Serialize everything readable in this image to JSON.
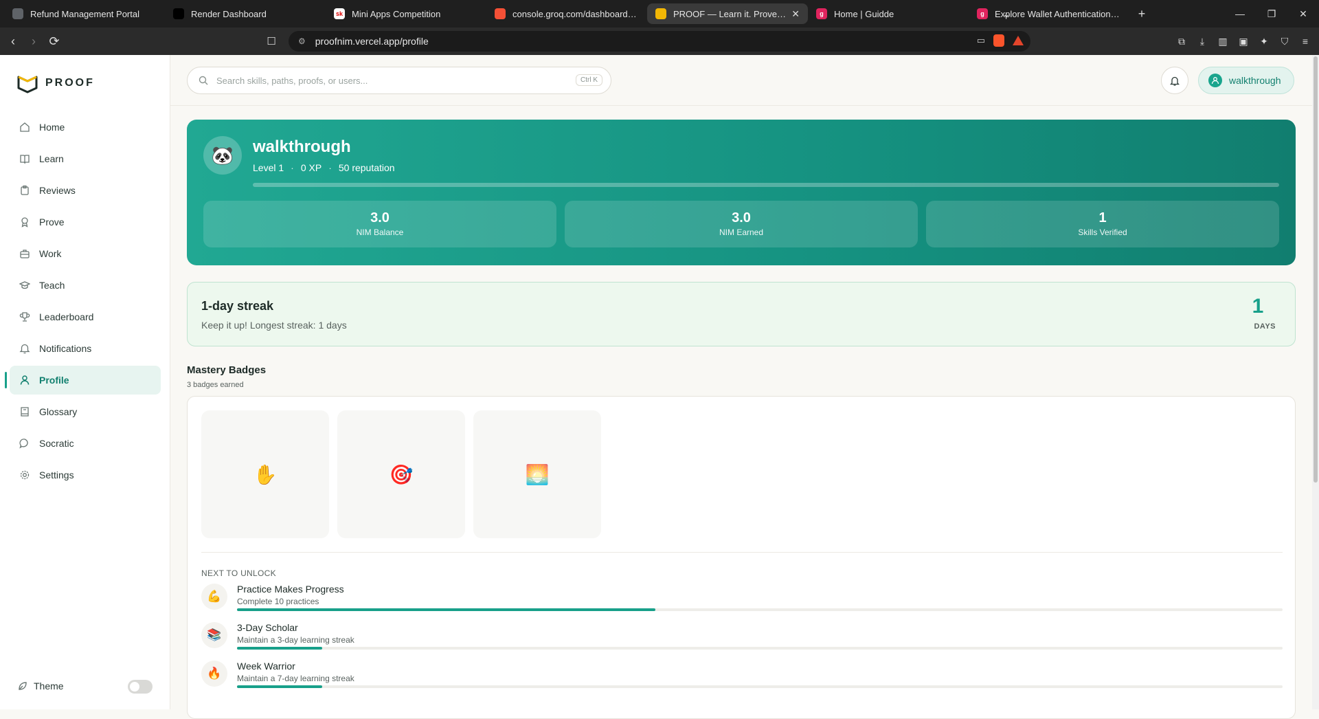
{
  "browser": {
    "tabs": [
      {
        "title": "Refund Management Portal",
        "favicon_color": "#5f6368",
        "favicon_text": ""
      },
      {
        "title": "Render Dashboard",
        "favicon_color": "#000000",
        "favicon_text": ""
      },
      {
        "title": "Mini Apps Competition",
        "favicon_color": "#ffffff",
        "favicon_text": "sk"
      },
      {
        "title": "console.groq.com/dashboard/metri",
        "favicon_color": "#f55036",
        "favicon_text": ""
      },
      {
        "title": "PROOF — Learn it. Prove it. Earn",
        "favicon_color": "#f2b705",
        "favicon_text": ""
      },
      {
        "title": "Home | Guidde",
        "favicon_color": "#e0245e",
        "favicon_text": "g"
      },
      {
        "title": "Explore Wallet Authentication and I",
        "favicon_color": "#e0245e",
        "favicon_text": "g"
      }
    ],
    "active_tab": 4,
    "url": "proofnim.vercel.app/profile"
  },
  "app": {
    "brand": "PROOF",
    "accent": "#18a08a",
    "nav": [
      {
        "label": "Home",
        "icon": "home-icon"
      },
      {
        "label": "Learn",
        "icon": "book-icon"
      },
      {
        "label": "Reviews",
        "icon": "clipboard-icon"
      },
      {
        "label": "Prove",
        "icon": "award-icon"
      },
      {
        "label": "Work",
        "icon": "briefcase-icon"
      },
      {
        "label": "Teach",
        "icon": "graduation-cap-icon"
      },
      {
        "label": "Leaderboard",
        "icon": "trophy-icon"
      },
      {
        "label": "Notifications",
        "icon": "bell-icon"
      },
      {
        "label": "Profile",
        "icon": "user-icon"
      },
      {
        "label": "Glossary",
        "icon": "glossary-icon"
      },
      {
        "label": "Socratic",
        "icon": "chat-icon"
      },
      {
        "label": "Settings",
        "icon": "gear-icon"
      }
    ],
    "active_nav": 8,
    "theme_label": "Theme",
    "theme_dark": false
  },
  "topbar": {
    "search_placeholder": "Search skills, paths, proofs, or users...",
    "shortcut": "Ctrl K",
    "user_label": "walkthrough"
  },
  "profile": {
    "avatar": "🐼",
    "username": "walkthrough",
    "level": "Level 1",
    "xp": "0 XP",
    "reputation": "50 reputation",
    "xp_progress": 0,
    "stats": [
      {
        "value": "3.0",
        "label": "NIM Balance"
      },
      {
        "value": "3.0",
        "label": "NIM Earned"
      },
      {
        "value": "1",
        "label": "Skills Verified"
      }
    ]
  },
  "streak": {
    "title": "1-day streak",
    "subtitle": "Keep it up! Longest streak: 1 days",
    "count": "1",
    "unit": "DAYS"
  },
  "badges": {
    "title": "Mastery Badges",
    "subtitle": "3 badges earned",
    "earned": [
      "✋",
      "🎯",
      "🌅"
    ],
    "next_heading": "NEXT TO UNLOCK",
    "next": [
      {
        "icon": "💪",
        "title": "Practice Makes Progress",
        "desc": "Complete 10 practices",
        "progress": 0.4
      },
      {
        "icon": "📚",
        "title": "3-Day Scholar",
        "desc": "Maintain a 3-day learning streak",
        "progress": 0.0816
      },
      {
        "icon": "🔥",
        "title": "Week Warrior",
        "desc": "Maintain a 7-day learning streak",
        "progress": 0.0816
      }
    ]
  }
}
